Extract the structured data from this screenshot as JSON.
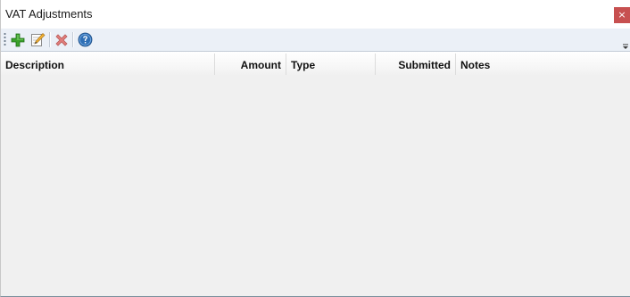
{
  "window": {
    "title": "VAT Adjustments",
    "close_label": "×"
  },
  "toolbar": {
    "buttons": [
      {
        "name": "add",
        "icon": "plus-icon",
        "color": "#3aa12b"
      },
      {
        "name": "edit",
        "icon": "pencil-notepad-icon",
        "color": "#e8a020"
      },
      {
        "name": "delete",
        "icon": "red-x-icon",
        "color": "#d9534f",
        "disabled": true
      },
      {
        "name": "help",
        "icon": "help-circle-icon",
        "color": "#2f6fb5"
      }
    ]
  },
  "grid": {
    "columns": [
      {
        "label": "Description"
      },
      {
        "label": "Amount"
      },
      {
        "label": "Type"
      },
      {
        "label": "Submitted"
      },
      {
        "label": "Notes"
      }
    ],
    "rows": []
  },
  "colors": {
    "toolbar_bg": "#ebf0f7",
    "close_bg": "#c75050",
    "grid_bg": "#f0f0f0"
  }
}
